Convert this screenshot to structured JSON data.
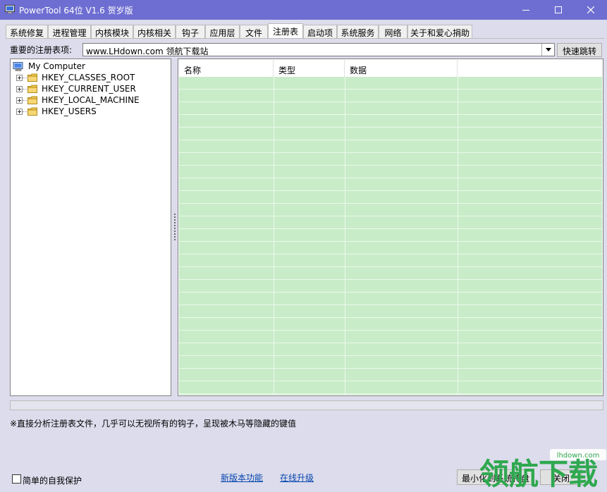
{
  "window": {
    "title": "PowerTool 64位 V1.6 贺岁版",
    "controls": {
      "minimize": "minimize-icon",
      "maximize": "maximize-icon",
      "close": "close-icon"
    }
  },
  "tabs": [
    {
      "label": "系统修复"
    },
    {
      "label": "进程管理"
    },
    {
      "label": "内核模块"
    },
    {
      "label": "内核相关"
    },
    {
      "label": "钩子"
    },
    {
      "label": "应用层"
    },
    {
      "label": "文件"
    },
    {
      "label": "注册表",
      "active": true
    },
    {
      "label": "启动项"
    },
    {
      "label": "系统服务"
    },
    {
      "label": "网络"
    },
    {
      "label": "关于和爱心捐助"
    }
  ],
  "registry": {
    "important_label": "重要的注册表项:",
    "combo_value": "www.LHdown.com 领航下载站",
    "quick_jump_label": "快速跳转"
  },
  "tree": {
    "root": "My Computer",
    "items": [
      "HKEY_CLASSES_ROOT",
      "HKEY_CURRENT_USER",
      "HKEY_LOCAL_MACHINE",
      "HKEY_USERS"
    ]
  },
  "list": {
    "columns": [
      "名称",
      "类型",
      "数据"
    ]
  },
  "hint_text": "※直接分析注册表文件，几乎可以无视所有的钩子，呈现被木马等隐藏的键值",
  "footer": {
    "self_protect_label": "简单的自我保护",
    "self_protect_checked": false,
    "new_features_link": "新版本功能",
    "online_upgrade_link": "在线升级",
    "minimize_tray_button": "最小化到系统托盘",
    "close_button": "关闭"
  },
  "watermark": {
    "brand": "领航下载",
    "url": "lhdown.com"
  },
  "colors": {
    "titlebar": "#6e6ed2",
    "list_background": "#c8ecc8",
    "watermark_green": "#2fa84f"
  }
}
